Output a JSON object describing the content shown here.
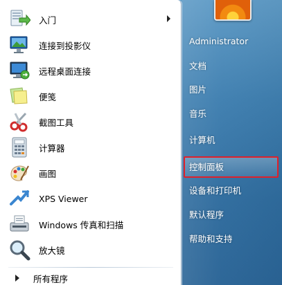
{
  "start_menu": {
    "programs": [
      {
        "label": "入门",
        "icon": "getting-started-icon",
        "has_submenu": true
      },
      {
        "label": "连接到投影仪",
        "icon": "projector-icon",
        "has_submenu": false
      },
      {
        "label": "远程桌面连接",
        "icon": "remote-desktop-icon",
        "has_submenu": false
      },
      {
        "label": "便笺",
        "icon": "sticky-notes-icon",
        "has_submenu": false
      },
      {
        "label": "截图工具",
        "icon": "snipping-tool-icon",
        "has_submenu": false
      },
      {
        "label": "计算器",
        "icon": "calculator-icon",
        "has_submenu": false
      },
      {
        "label": "画图",
        "icon": "paint-icon",
        "has_submenu": false
      },
      {
        "label": "XPS Viewer",
        "icon": "xps-viewer-icon",
        "has_submenu": false
      },
      {
        "label": "Windows 传真和扫描",
        "icon": "fax-scan-icon",
        "has_submenu": false
      },
      {
        "label": "放大镜",
        "icon": "magnifier-icon",
        "has_submenu": false
      }
    ],
    "all_programs_label": "所有程序",
    "right_links": [
      {
        "label": "Administrator"
      },
      {
        "label": "文档"
      },
      {
        "label": "图片"
      },
      {
        "label": "音乐"
      },
      {
        "label": "计算机"
      },
      {
        "label": "控制面板",
        "highlighted": true
      },
      {
        "label": "设备和打印机"
      },
      {
        "label": "默认程序"
      },
      {
        "label": "帮助和支持"
      }
    ],
    "highlight_color": "#e0202a"
  }
}
